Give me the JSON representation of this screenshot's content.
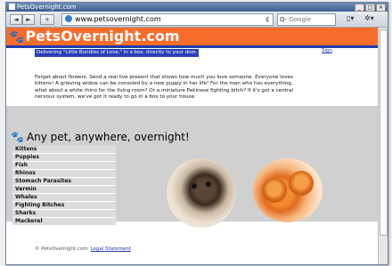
{
  "window": {
    "title": "PetsOvernight.com"
  },
  "toolbar": {
    "back": "◄",
    "forward": "►",
    "add": "+",
    "url": "www.petsovernight.com",
    "reload": "¢",
    "search_placeholder": "Google",
    "search_prefix": "Q-"
  },
  "site": {
    "brand": "PetsOvernight.com",
    "tagline": "Delivering \"Little Bundles of Love,\" in a box, directly to your door.",
    "signin": "Sign",
    "intro": "Forget about flowers. Send a real live present that shows how much you love someone. Everyone loves kittens! A grieving widow can be consoled by a new puppy in her life! For the man who has everything, what about a white rhino for the living room? Or a miniature Pekinese fighting bitch? If it's got a central nervous system, we've got it ready to go in a box to your house.",
    "section_title": "Any pet, anywhere, overnight!",
    "pets": [
      "Kittens",
      "Puppies",
      "Fish",
      "Rhinos",
      "Stomach Parasites",
      "Vermin",
      "Whales",
      "Fighting Bitches",
      "Sharks",
      "Mackerel"
    ],
    "footer_copy": "© PetsOvernight.com",
    "footer_link": "Legal Statement"
  },
  "colors": {
    "brand_orange": "#f86c2c",
    "brand_blue": "#1f3ba8"
  }
}
